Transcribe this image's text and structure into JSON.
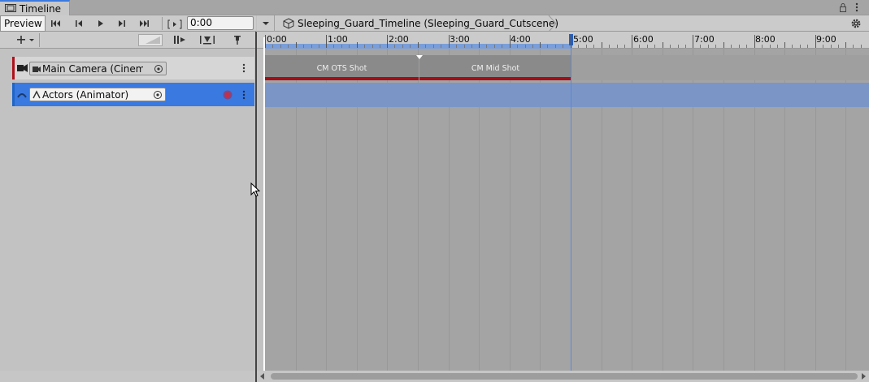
{
  "window": {
    "tab_label": "Timeline",
    "icons": [
      "film-icon",
      "lock-icon",
      "kebab-menu-icon"
    ]
  },
  "toolbar": {
    "preview_label": "Preview",
    "time_value": "0:00",
    "buttons": [
      "jump-to-start-icon",
      "previous-frame-icon",
      "play-icon",
      "next-frame-icon",
      "jump-to-end-icon",
      "play-range-icon"
    ]
  },
  "breadcrumb": {
    "label": "Sleeping_Guard_Timeline (Sleeping_Guard_Cutscene)"
  },
  "ruler": {
    "labels": [
      "0:00",
      "1:00",
      "2:00",
      "3:00",
      "4:00",
      "5:00",
      "6:00",
      "7:00",
      "8:00",
      "9:00"
    ],
    "end_time": "5:00"
  },
  "tracks": [
    {
      "label": "Main Camera (Cinemac",
      "type": "cinemachine",
      "color": "#b0101a"
    },
    {
      "label": "Actors (Animator)",
      "type": "animator",
      "color": "#3a79e0",
      "selected": true
    }
  ],
  "clips": [
    {
      "label": "CM OTS Shot"
    },
    {
      "label": "CM Mid Shot"
    }
  ],
  "colors": {
    "accent": "#3a79e0",
    "clip_bar": "#a30d16",
    "playhead": "#ffffff"
  }
}
